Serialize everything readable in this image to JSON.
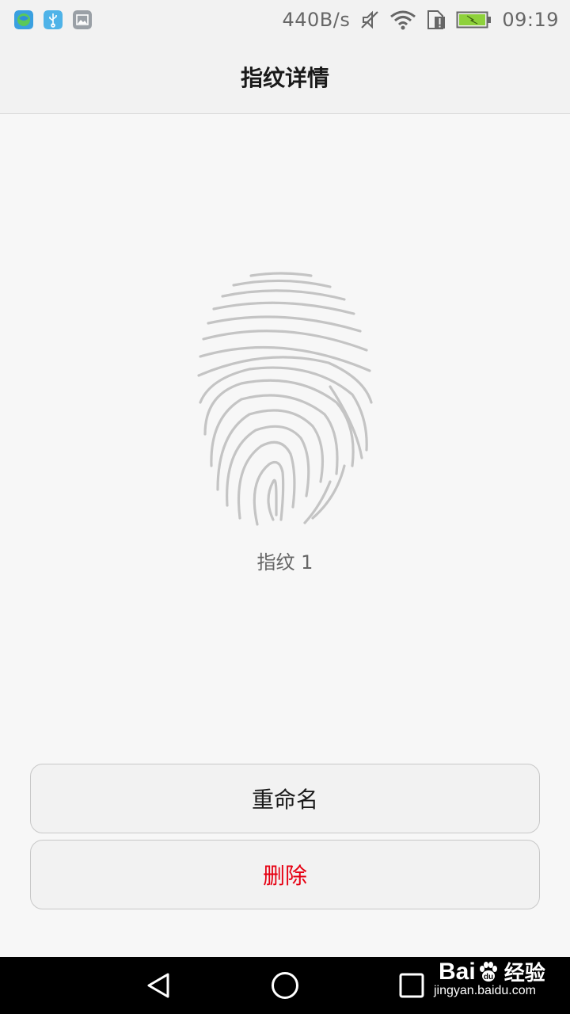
{
  "status_bar": {
    "net_speed": "440B/s",
    "time": "09:19",
    "icons": [
      "app-notification-icon",
      "usb-icon",
      "image-icon",
      "mute-icon",
      "wifi-icon",
      "sim-card-icon",
      "battery-charging-icon"
    ]
  },
  "header": {
    "title": "指纹详情"
  },
  "fingerprint": {
    "icon": "fingerprint-icon",
    "label": "指纹 1"
  },
  "actions": {
    "rename_label": "重命名",
    "delete_label": "删除",
    "delete_color": "#e60012"
  },
  "nav": {
    "icons": [
      "back-icon",
      "home-icon",
      "recent-apps-icon"
    ]
  },
  "watermark": {
    "brand_left": "Bai",
    "brand_right": "经验",
    "url": "jingyan.baidu.com"
  }
}
